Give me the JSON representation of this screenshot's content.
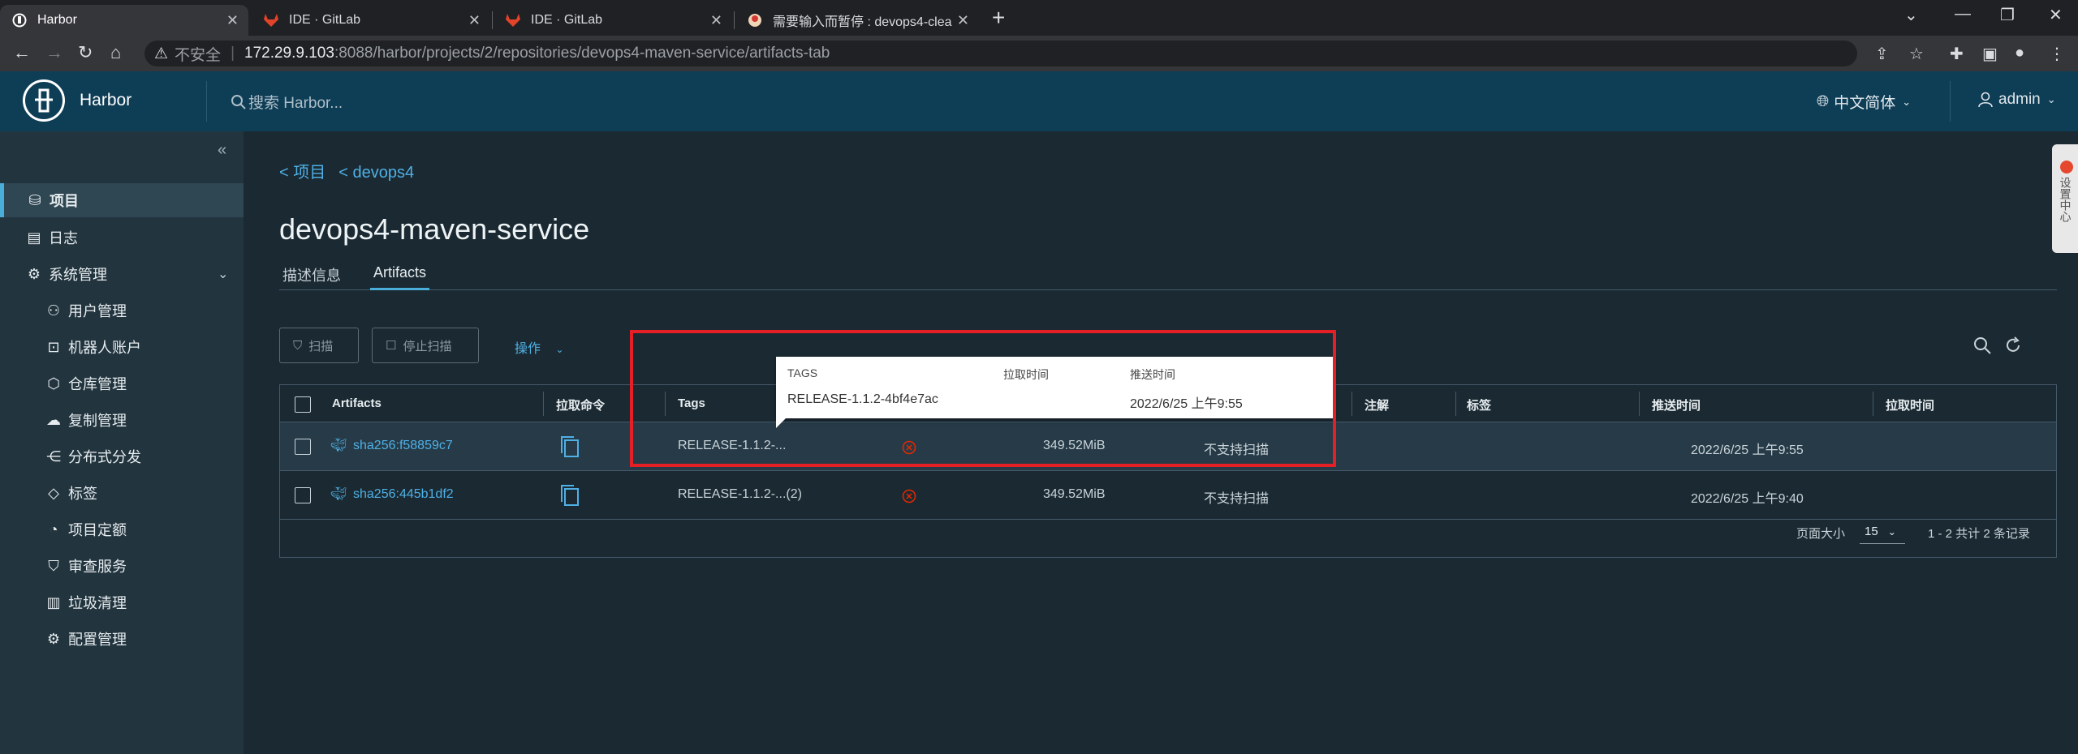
{
  "browser": {
    "tabs": [
      {
        "title": "Harbor",
        "active": true
      },
      {
        "title": "IDE · GitLab",
        "active": false
      },
      {
        "title": "IDE · GitLab",
        "active": false
      },
      {
        "title": "需要输入而暂停 : devops4-clea",
        "active": false
      }
    ],
    "address": {
      "security_label": "不安全",
      "host": "172.29.9.103",
      "path": ":8088/harbor/projects/2/repositories/devops4-maven-service/artifacts-tab"
    }
  },
  "header": {
    "brand": "Harbor",
    "search_placeholder": "搜索 Harbor...",
    "language": "中文简体",
    "user": "admin"
  },
  "sidebar": {
    "items": [
      {
        "label": "项目",
        "icon": "project-icon",
        "active": true
      },
      {
        "label": "日志",
        "icon": "log-icon"
      },
      {
        "label": "系统管理",
        "icon": "system-admin-icon",
        "expandable": true
      },
      {
        "label": "用户管理",
        "icon": "users-icon"
      },
      {
        "label": "机器人账户",
        "icon": "robot-icon"
      },
      {
        "label": "仓库管理",
        "icon": "registry-icon"
      },
      {
        "label": "复制管理",
        "icon": "replication-icon"
      },
      {
        "label": "分布式分发",
        "icon": "distribution-icon"
      },
      {
        "label": "标签",
        "icon": "tag-icon"
      },
      {
        "label": "项目定额",
        "icon": "quota-icon"
      },
      {
        "label": "审查服务",
        "icon": "shield-icon"
      },
      {
        "label": "垃圾清理",
        "icon": "trash-icon"
      },
      {
        "label": "配置管理",
        "icon": "gear-icon"
      }
    ]
  },
  "breadcrumb": [
    "< 项目",
    "< devops4"
  ],
  "page_title": "devops4-maven-service",
  "subtabs": [
    {
      "label": "描述信息",
      "active": false
    },
    {
      "label": "Artifacts",
      "active": true
    }
  ],
  "toolbar": {
    "scan": "扫描",
    "stop_scan": "停止扫描",
    "actions": "操作"
  },
  "table": {
    "columns": [
      "Artifacts",
      "拉取命令",
      "Tags",
      "注解",
      "标签",
      "推送时间",
      "拉取时间"
    ],
    "rows": [
      {
        "digest": "sha256:f58859c7",
        "tags": "RELEASE-1.1.2-...",
        "size": "349.52MiB",
        "vulnerabilities": "不支持扫描",
        "push_time": "2022/6/25 上午9:55",
        "pull_time": ""
      },
      {
        "digest": "sha256:445b1df2",
        "tags": "RELEASE-1.1.2-...(2)",
        "size": "349.52MiB",
        "vulnerabilities": "不支持扫描",
        "push_time": "2022/6/25 上午9:40",
        "pull_time": ""
      }
    ],
    "footer": {
      "page_size_label": "页面大小",
      "page_size": "15",
      "summary": "1 - 2 共计 2 条记录"
    }
  },
  "tooltip": {
    "headers": [
      "TAGS",
      "拉取时间",
      "推送时间"
    ],
    "values": [
      "RELEASE-1.1.2-4bf4e7ac",
      "",
      "2022/6/25 上午9:55"
    ]
  },
  "float_widget": {
    "badge": "m",
    "label": "设置中心"
  },
  "colors": {
    "accent": "#49afd9",
    "link": "#4fb0e6",
    "header_bg": "#0e3d56",
    "highlight_box": "#e51f26"
  }
}
